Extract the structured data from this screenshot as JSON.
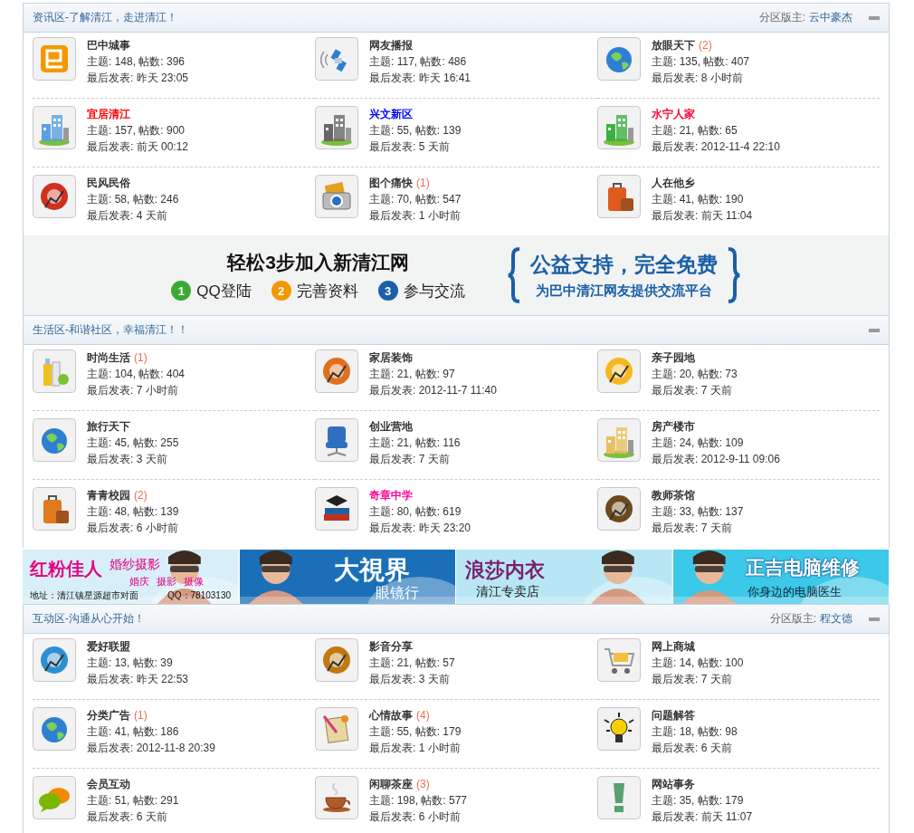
{
  "blocks": [
    {
      "kind": "section",
      "title": "资讯区-了解清江，走进清江！",
      "moderator_label": "分区版主:",
      "moderator": "云中豪杰",
      "forums": [
        {
          "name": "巴中城事",
          "color": "#333333",
          "stats": "主题: 148, 帖数: 396",
          "last": "最后发表: 昨天 23:05"
        },
        {
          "name": "网友播报",
          "color": "#333333",
          "stats": "主题: 117, 帖数: 486",
          "last": "最后发表: 昨天 16:41"
        },
        {
          "name": "放眼天下",
          "color": "#333333",
          "new": "(2)",
          "stats": "主题: 135, 帖数: 407",
          "last": "最后发表: 8 小时前"
        },
        {
          "name": "宜居清江",
          "color": "#ff0000",
          "stats": "主题: 157, 帖数: 900",
          "last": "最后发表: 前天 00:12"
        },
        {
          "name": "兴文新区",
          "color": "#0000ff",
          "stats": "主题: 55, 帖数: 139",
          "last": "最后发表: 5 天前"
        },
        {
          "name": "水宁人家",
          "color": "#ff0033",
          "stats": "主题: 21, 帖数: 65",
          "last": "最后发表: 2012-11-4 22:10"
        },
        {
          "name": "民风民俗",
          "color": "#333333",
          "stats": "主题: 58, 帖数: 246",
          "last": "最后发表: 4 天前"
        },
        {
          "name": "图个痛快",
          "color": "#333333",
          "new": "(1)",
          "stats": "主题: 70, 帖数: 547",
          "last": "最后发表: 1 小时前"
        },
        {
          "name": "人在他乡",
          "color": "#333333",
          "stats": "主题: 41, 帖数: 190",
          "last": "最后发表: 前天 11:04"
        }
      ]
    },
    {
      "kind": "join_banner",
      "title": "轻松3步加入新清江网",
      "steps": [
        {
          "number": "1",
          "label": "QQ登陆",
          "color": "#3aaa35"
        },
        {
          "number": "2",
          "label": "完善资料",
          "color": "#f39800"
        },
        {
          "number": "3",
          "label": "参与交流",
          "color": "#1a5fa8"
        }
      ],
      "slogan": "公益支持，完全免费",
      "subline": "为巴中清江网友提供交流平台"
    },
    {
      "kind": "section",
      "title": "生活区-和谐社区，幸福清江！！",
      "forums": [
        {
          "name": "时尚生活",
          "color": "#333333",
          "new": "(1)",
          "stats": "主题: 104, 帖数: 404",
          "last": "最后发表: 7 小时前"
        },
        {
          "name": "家居装饰",
          "color": "#333333",
          "stats": "主题: 21, 帖数: 97",
          "last": "最后发表: 2012-11-7 11:40"
        },
        {
          "name": "亲子园地",
          "color": "#333333",
          "stats": "主题: 20, 帖数: 73",
          "last": "最后发表: 7 天前"
        },
        {
          "name": "旅行天下",
          "color": "#333333",
          "stats": "主题: 45, 帖数: 255",
          "last": "最后发表: 3 天前"
        },
        {
          "name": "创业营地",
          "color": "#333333",
          "stats": "主题: 21, 帖数: 116",
          "last": "最后发表: 7 天前"
        },
        {
          "name": "房产楼市",
          "color": "#333333",
          "stats": "主题: 24, 帖数: 109",
          "last": "最后发表: 2012-9-11 09:06"
        },
        {
          "name": "青青校园",
          "color": "#333333",
          "new": "(2)",
          "stats": "主题: 48, 帖数: 139",
          "last": "最后发表: 6 小时前"
        },
        {
          "name": "奇章中学",
          "color": "#ff0099",
          "stats": "主题: 80, 帖数: 619",
          "last": "最后发表: 昨天 23:20"
        },
        {
          "name": "教师茶馆",
          "color": "#333333",
          "stats": "主题: 33, 帖数: 137",
          "last": "最后发表: 7 天前"
        }
      ]
    },
    {
      "kind": "ad_strip",
      "ads": [
        {
          "texts": [
            "红粉佳人",
            "婚纱摄影",
            "婚庆",
            "摄影",
            "摄像",
            "地址：清江镇星源超市对面",
            "QQ：78103130"
          ]
        },
        {
          "texts": [
            "大視界",
            "眼镜行"
          ]
        },
        {
          "texts": [
            "浪莎内衣",
            "清江专卖店"
          ]
        },
        {
          "texts": [
            "正吉电脑维修",
            "你身边的电脑医生"
          ]
        }
      ]
    },
    {
      "kind": "section",
      "title": "互动区-沟通从心开始！",
      "moderator_label": "分区版主:",
      "moderator": "程文德",
      "forums": [
        {
          "name": "爱好联盟",
          "color": "#333333",
          "stats": "主题: 13, 帖数: 39",
          "last": "最后发表: 昨天 22:53"
        },
        {
          "name": "影音分享",
          "color": "#333333",
          "stats": "主题: 21, 帖数: 57",
          "last": "最后发表: 3 天前"
        },
        {
          "name": "网上商城",
          "color": "#333333",
          "stats": "主题: 14, 帖数: 100",
          "last": "最后发表: 7 天前"
        },
        {
          "name": "分类广告",
          "color": "#333333",
          "new": "(1)",
          "stats": "主题: 41, 帖数: 186",
          "last": "最后发表: 2012-11-8 20:39"
        },
        {
          "name": "心情故事",
          "color": "#333333",
          "new": "(4)",
          "stats": "主题: 55, 帖数: 179",
          "last": "最后发表: 1 小时前"
        },
        {
          "name": "问题解答",
          "color": "#333333",
          "stats": "主题: 18, 帖数: 98",
          "last": "最后发表: 6 天前"
        },
        {
          "name": "会员互动",
          "color": "#333333",
          "stats": "主题: 51, 帖数: 291",
          "last": "最后发表: 6 天前"
        },
        {
          "name": "闲聊茶座",
          "color": "#333333",
          "new": "(3)",
          "stats": "主题: 198, 帖数: 577",
          "last": "最后发表: 6 小时前"
        },
        {
          "name": "网站事务",
          "color": "#333333",
          "stats": "主题: 35, 帖数: 179",
          "last": "最后发表: 前天 11:07"
        }
      ]
    }
  ]
}
